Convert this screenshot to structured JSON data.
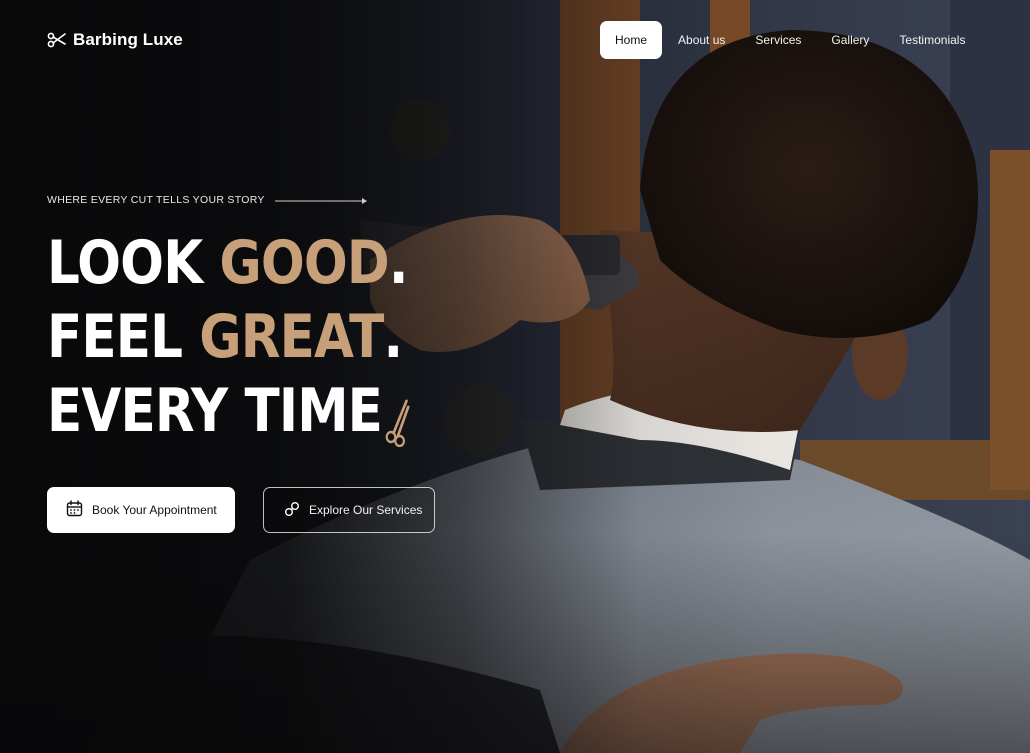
{
  "brand": {
    "name": "Barbing Luxe",
    "logo_icon": "scissors-icon"
  },
  "nav": {
    "items": [
      {
        "label": "Home",
        "active": true
      },
      {
        "label": "About us",
        "active": false
      },
      {
        "label": "Services",
        "active": false
      },
      {
        "label": "Gallery",
        "active": false
      },
      {
        "label": "Testimonials",
        "active": false
      }
    ]
  },
  "hero": {
    "tagline": "WHERE EVERY CUT TELLS YOUR STORY",
    "headline": {
      "line1_white": "LOOK ",
      "line1_gold": "GOOD",
      "line1_end": ".",
      "line2_white": "FEEL ",
      "line2_gold": "GREAT",
      "line2_end": ".",
      "line3_white": "EVERY TIME"
    },
    "primary_button": {
      "label": "Book Your Appointment",
      "icon": "calendar-icon"
    },
    "secondary_button": {
      "label": "Explore Our Services",
      "icon": "link-icon"
    }
  },
  "colors": {
    "accent_gold": "#c7a07a",
    "background": "#0b0b0c",
    "button_light": "#ffffff"
  }
}
